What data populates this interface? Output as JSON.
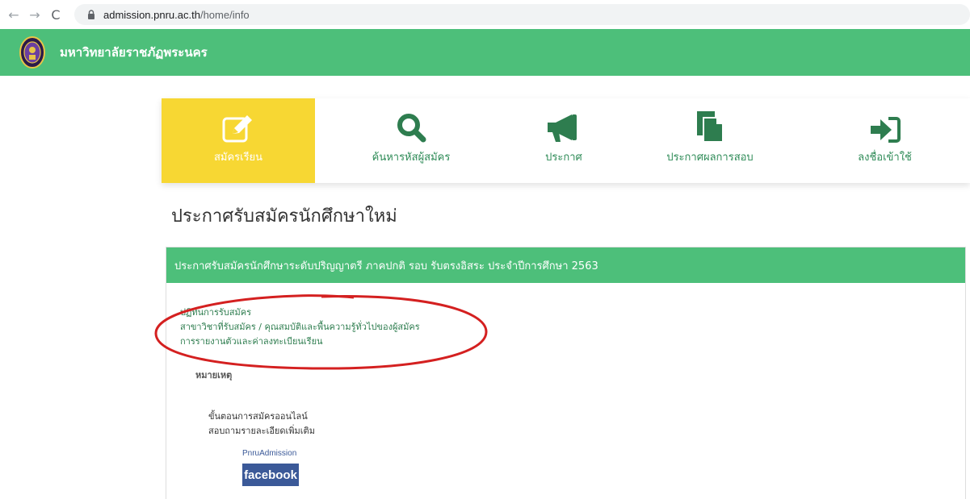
{
  "browser": {
    "back_icon": "←",
    "forward_icon": "→",
    "reload_icon": "C",
    "url_host": "admission.pnru.ac.th",
    "url_path": "/home/info"
  },
  "header": {
    "site_name": "มหาวิทยาลัยราชภัฏพระนคร",
    "background_color": "#4dbf7a"
  },
  "menu": {
    "active_color": "#f7d733",
    "items": [
      {
        "label": "สมัครเรียน",
        "icon": "edit-icon"
      },
      {
        "label": "ค้นหารหัสผู้สมัคร",
        "icon": "search-icon"
      },
      {
        "label": "ประกาศ",
        "icon": "megaphone-icon"
      },
      {
        "label": "ประกาศผลการสอบ",
        "icon": "document-icon"
      },
      {
        "label": "ลงชื่อเข้าใช้",
        "icon": "sign-in-icon"
      }
    ]
  },
  "content": {
    "page_title": "ประกาศรับสมัครนักศึกษาใหม่",
    "panel_heading": "ประกาศรับสมัครนักศึกษาระดับปริญญาตรี ภาคปกติ รอบ รับตรงอิสระ ประจำปีการศึกษา 2563",
    "links": [
      "ปฏิทินการรับสมัคร",
      "สาขาวิชาที่รับสมัคร / คุณสมบัติและพื้นความรู้ทั่วไปของผู้สมัคร",
      "การรายงานตัวและค่าลงทะเบียนเรียน"
    ],
    "note_title": "หมายเหตุ",
    "sub_links": [
      "ขั้นตอนการสมัครออนไลน์",
      "สอบถามรายละเอียดเพิ่มเติม"
    ],
    "facebook_label": "PnruAdmission",
    "facebook_button": "facebook"
  }
}
